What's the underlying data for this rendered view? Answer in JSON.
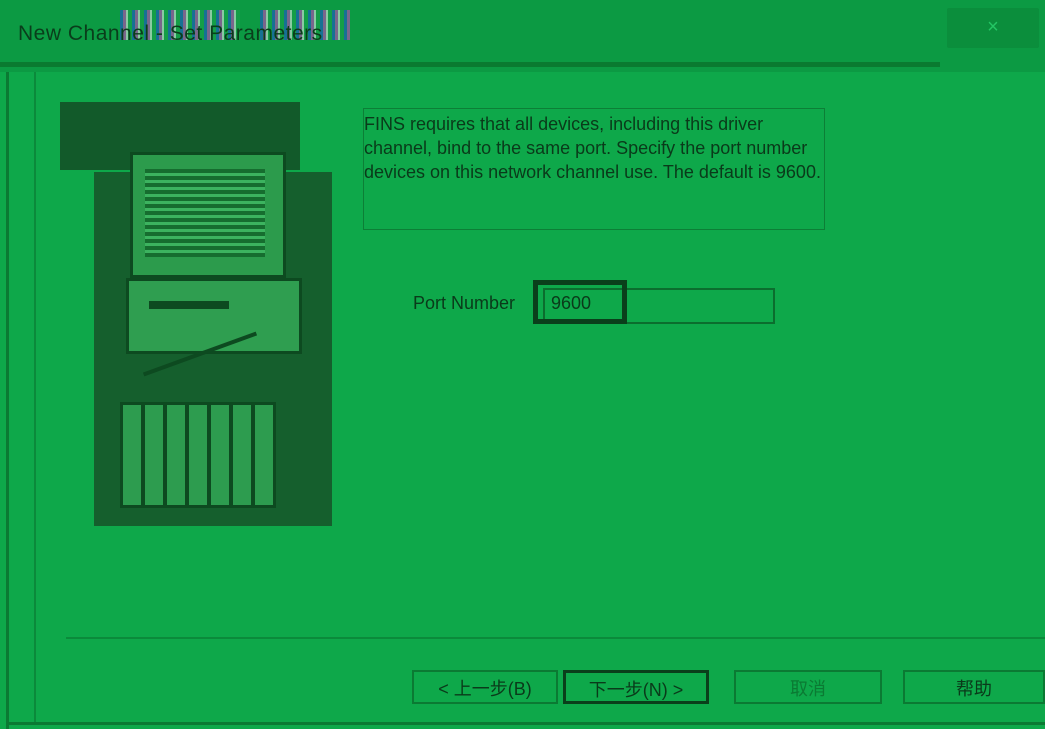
{
  "window": {
    "title": "New Channel - Set Parameters",
    "close_glyph": "×"
  },
  "description": "FINS requires that all devices, including this driver channel, bind to the same port. Specify the port number devices on this network channel use. The default is 9600.",
  "port": {
    "label": "Port Number",
    "value": "9600"
  },
  "buttons": {
    "back": "< 上一步(B)",
    "next": "下一步(N) >",
    "cancel": "取消",
    "help": "帮助"
  },
  "colors": {
    "background": "#0ea84a",
    "text": "#0a3a1a"
  }
}
